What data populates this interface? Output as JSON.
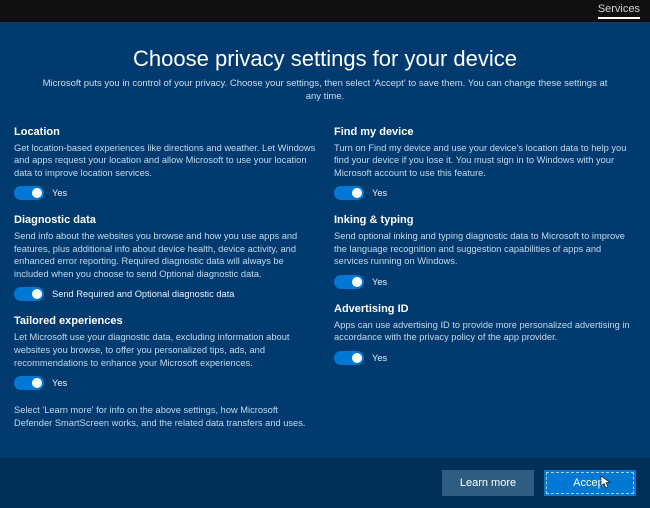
{
  "topbar": {
    "services": "Services"
  },
  "title": "Choose privacy settings for your device",
  "subtitle": "Microsoft puts you in control of your privacy. Choose your settings, then select 'Accept' to save them. You can change these settings at any time.",
  "left": {
    "location": {
      "heading": "Location",
      "desc": "Get location-based experiences like directions and weather. Let Windows and apps request your location and allow Microsoft to use your location data to improve location services.",
      "value": "Yes"
    },
    "diagnostic": {
      "heading": "Diagnostic data",
      "desc": "Send info about the websites you browse and how you use apps and features, plus additional info about device health, device activity, and enhanced error reporting. Required diagnostic data will always be included when you choose to send Optional diagnostic data.",
      "value": "Send Required and Optional diagnostic data"
    },
    "tailored": {
      "heading": "Tailored experiences",
      "desc": "Let Microsoft use your diagnostic data, excluding information about websites you browse, to offer you personalized tips, ads, and recommendations to enhance your Microsoft experiences.",
      "value": "Yes"
    },
    "footnote": "Select 'Learn more' for info on the above settings, how Microsoft Defender SmartScreen works, and the related data transfers and uses."
  },
  "right": {
    "findmydevice": {
      "heading": "Find my device",
      "desc": "Turn on Find my device and use your device's location data to help you find your device if you lose it. You must sign in to Windows with your Microsoft account to use this feature.",
      "value": "Yes"
    },
    "inking": {
      "heading": "Inking & typing",
      "desc": "Send optional inking and typing diagnostic data to Microsoft to improve the language recognition and suggestion capabilities of apps and services running on Windows.",
      "value": "Yes"
    },
    "advertising": {
      "heading": "Advertising ID",
      "desc": "Apps can use advertising ID to provide more personalized advertising in accordance with the privacy policy of the app provider.",
      "value": "Yes"
    }
  },
  "footer": {
    "learn_more": "Learn more",
    "accept": "Accept"
  }
}
